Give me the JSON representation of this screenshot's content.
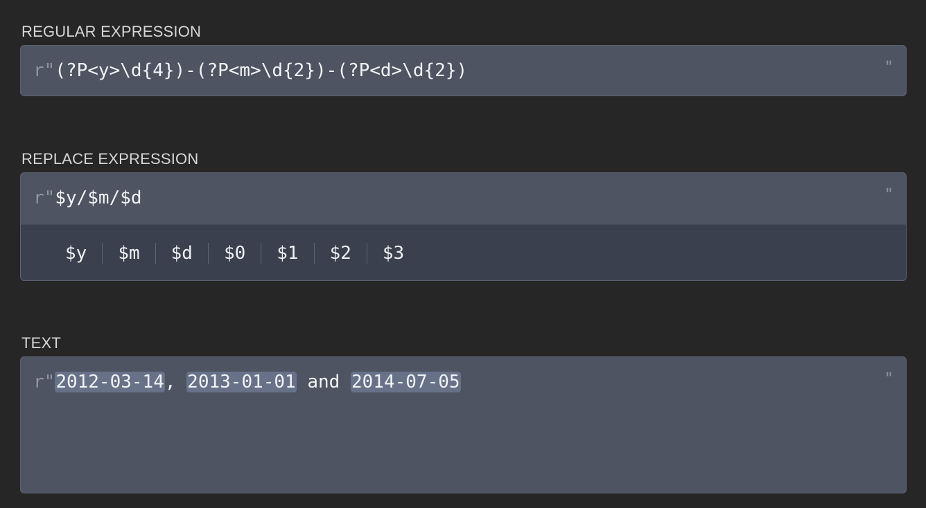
{
  "regex": {
    "label": "REGULAR EXPRESSION",
    "prefix": "r\"",
    "value": "(?P<y>\\d{4})-(?P<m>\\d{2})-(?P<d>\\d{2})",
    "suffix": "\""
  },
  "replace": {
    "label": "REPLACE EXPRESSION",
    "prefix": "r\"",
    "value": "$y/$m/$d",
    "suffix": "\"",
    "tokens": [
      "$y",
      "$m",
      "$d",
      "$0",
      "$1",
      "$2",
      "$3"
    ]
  },
  "text": {
    "label": "TEXT",
    "prefix": "r\"",
    "suffix": "\"",
    "segments": [
      {
        "text": "2012-03-14",
        "match": true
      },
      {
        "text": ", ",
        "match": false
      },
      {
        "text": "2013-01-01",
        "match": true
      },
      {
        "text": " and ",
        "match": false
      },
      {
        "text": "2014-07-05",
        "match": true
      }
    ]
  },
  "colors": {
    "background": "#262626",
    "field": "#4e5461",
    "hint_bar": "#3a404d",
    "match_highlight": "#677188"
  }
}
